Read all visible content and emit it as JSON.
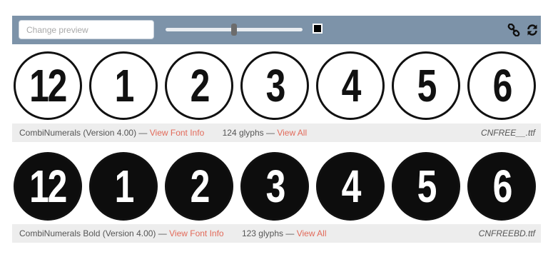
{
  "toolbar": {
    "preview_placeholder": "Change preview",
    "preview_value": "",
    "size_slider_value_fraction": 0.5,
    "color_swatch": "#000000",
    "icons": [
      "link-icon",
      "refresh-icon"
    ]
  },
  "fonts": [
    {
      "style": "outline",
      "glyphs": [
        "12",
        "1",
        "2",
        "3",
        "4",
        "5",
        "6"
      ],
      "name": "CombiNumerals (Version 4.00)",
      "separator": "—",
      "view_info_label": "View Font Info",
      "glyph_count": "124 glyphs",
      "view_all_label": "View All",
      "filename": "CNFREE__.ttf"
    },
    {
      "style": "filled",
      "glyphs": [
        "12",
        "1",
        "2",
        "3",
        "4",
        "5",
        "6"
      ],
      "name": "CombiNumerals Bold (Version 4.00)",
      "separator": "—",
      "view_info_label": "View Font Info",
      "glyph_count": "123 glyphs",
      "view_all_label": "View All",
      "filename": "CNFREEBD.ttf"
    }
  ],
  "colors": {
    "toolbar_bg": "#7d93a9",
    "link_accent": "#e26a5a",
    "info_bar_bg": "#ededed"
  }
}
